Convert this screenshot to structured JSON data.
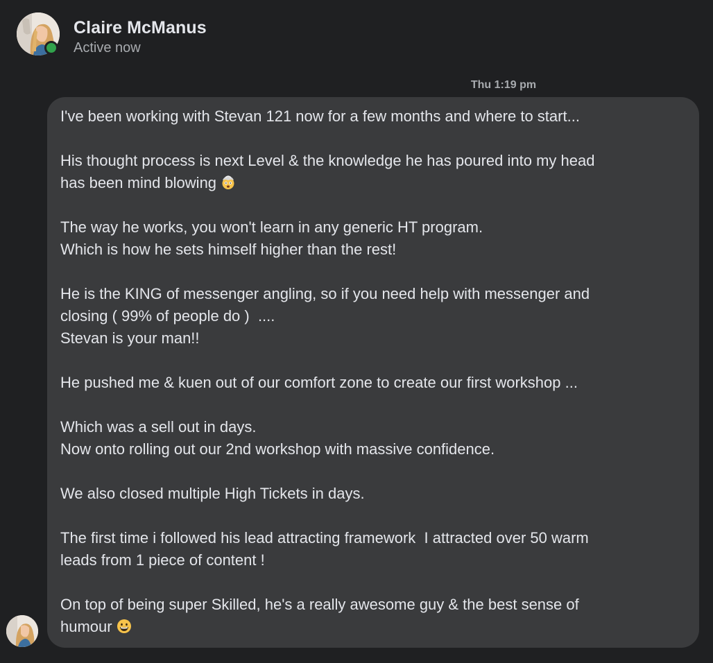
{
  "header": {
    "name": "Claire McManus",
    "status": "Active now",
    "avatar_icon": "profile-photo",
    "presence_color": "#31a24c"
  },
  "thread": {
    "timestamp": "Thu 1:19 pm",
    "message": {
      "paragraphs": [
        "I've been working with Stevan 121 now for a few months and where to start...",
        "His thought process is next Level & the knowledge he has poured into my head\nhas been mind blowing",
        "The way he works, you won't learn in any generic HT program.\nWhich is how he sets himself higher than the rest!",
        "He is the KING of messenger angling, so if you need help with messenger and\nclosing ( 99% of people do )  ....\nStevan is your man!!",
        "He pushed me & kuen out of our comfort zone to create our first workshop ...",
        "Which was a sell out in days.\nNow onto rolling out our 2nd workshop with massive confidence.",
        "We also closed multiple High Tickets in days.",
        "The first time i followed his lead attracting framework  I attracted over 50 warm\nleads from 1 piece of content !",
        "On top of being super Skilled, he's a really awesome guy & the best sense of\nhumour"
      ],
      "emojis": {
        "p2": "exploding-head-emoji",
        "p9": "grinning-face-emoji"
      }
    }
  },
  "colors": {
    "background": "#1f2022",
    "bubble": "#3a3b3d",
    "text": "#e4e6eb",
    "muted": "#a8abaf"
  }
}
